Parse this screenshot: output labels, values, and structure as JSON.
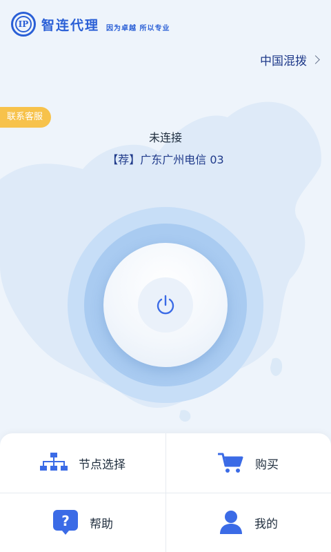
{
  "header": {
    "logo_text": "IP",
    "brand": "智连代理",
    "slogan": "因为卓越 所以专业"
  },
  "region": {
    "label": "中国混拨"
  },
  "support": {
    "label": "联系客服"
  },
  "connection": {
    "status": "未连接",
    "node": "【荐】广东广州电信 03"
  },
  "menu": {
    "node_select": "节点选择",
    "buy": "购买",
    "help": "帮助",
    "mine": "我的"
  },
  "colors": {
    "accent": "#2a5fd6",
    "icon_blue": "#3b6be6",
    "badge_yellow": "#f7c24b",
    "ring_outer": "#c7def7",
    "ring_inner": "#a9cbf1"
  },
  "icons": {
    "power": "power-icon",
    "node_select": "network-tree-icon",
    "buy": "shopping-cart-icon",
    "help": "help-icon",
    "mine": "user-icon",
    "region_chevron": "chevron-right-icon"
  }
}
